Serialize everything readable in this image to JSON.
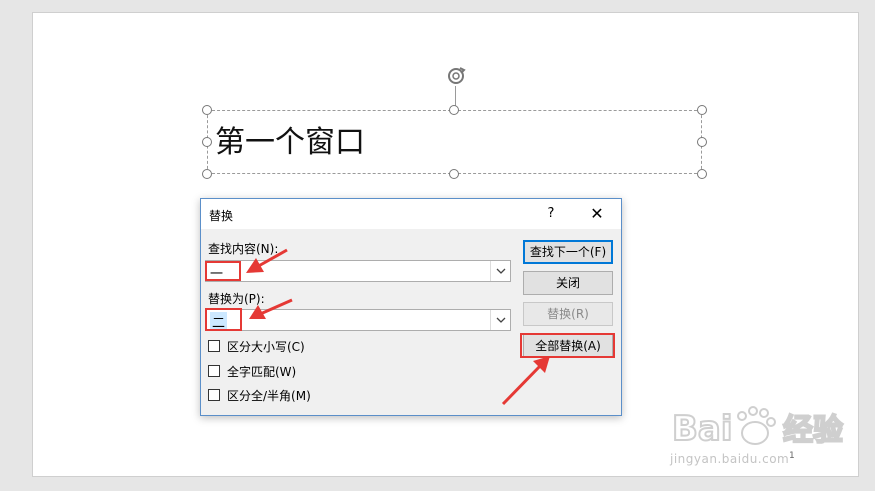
{
  "slide": {
    "text": "第一个窗口",
    "page_number": "1"
  },
  "dialog": {
    "title": "替换",
    "help_label": "?",
    "close_label": "✕",
    "find_label": "查找内容(N):",
    "find_value": "一",
    "replace_label": "替换为(P):",
    "replace_value": "二",
    "buttons": {
      "find_next": "查找下一个(F)",
      "close": "关闭",
      "replace": "替换(R)",
      "replace_all": "全部替换(A)"
    },
    "options": [
      {
        "label": "区分大小写(C)",
        "checked": false
      },
      {
        "label": "全字匹配(W)",
        "checked": false
      },
      {
        "label": "区分全/半角(M)",
        "checked": false
      }
    ]
  },
  "watermark": {
    "logo": "Bai du 经验",
    "domain": "jingyan.baidu.com"
  },
  "icons": [
    "rotate-icon",
    "dropdown-arrow-icon",
    "checkbox-icon",
    "paw-icon"
  ],
  "colors": {
    "annotation": "#e53935",
    "dialog_border": "#5b8fc9",
    "primary_button": "#0078d7",
    "selection": "#cce8ff"
  }
}
